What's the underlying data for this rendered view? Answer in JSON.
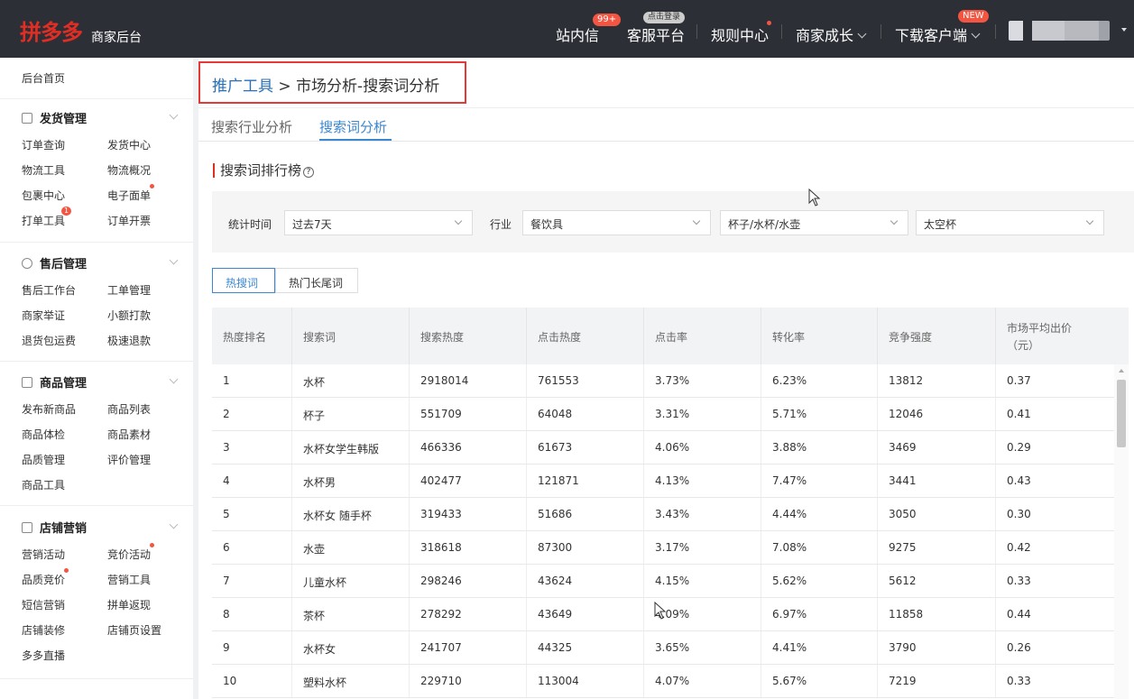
{
  "topbar": {
    "logo": "拼多多",
    "logo_sub": "商家后台",
    "nav": {
      "messages": "站内信",
      "messages_badge": "99+",
      "service": "客服平台",
      "service_badge": "点击登录",
      "rules": "规则中心",
      "growth": "商家成长",
      "download": "下载客户端",
      "download_badge": "NEW"
    }
  },
  "sidebar": {
    "home": "后台首页",
    "sections": [
      {
        "title": "发货管理",
        "links": [
          "订单查询",
          "发货中心",
          "物流工具",
          "物流概况",
          "包裹中心",
          "电子面单",
          "打单工具",
          "订单开票"
        ]
      },
      {
        "title": "售后管理",
        "links": [
          "售后工作台",
          "工单管理",
          "商家举证",
          "小额打款",
          "退货包运费",
          "极速退款"
        ]
      },
      {
        "title": "商品管理",
        "links": [
          "发布新商品",
          "商品列表",
          "商品体检",
          "商品素材",
          "品质管理",
          "评价管理",
          "商品工具"
        ]
      },
      {
        "title": "店铺营销",
        "links": [
          "营销活动",
          "竞价活动",
          "品质竞价",
          "营销工具",
          "短信营销",
          "拼单返现",
          "店铺装修",
          "店铺页设置",
          "多多直播"
        ]
      }
    ],
    "badge_print": "1"
  },
  "main": {
    "breadcrumb_link": "推广工具",
    "breadcrumb_sep": " > ",
    "breadcrumb_current": "市场分析-搜索词分析",
    "tabs": [
      "搜索行业分析",
      "搜索词分析"
    ],
    "section_title": "搜索词排行榜",
    "filters": {
      "time_label": "统计时间",
      "time_value": "过去7天",
      "industry_label": "行业",
      "industry_value": "餐饮具",
      "cat2_value": "杯子/水杯/水壶",
      "cat3_value": "太空杯"
    },
    "segments": [
      "热搜词",
      "热门长尾词"
    ],
    "columns": [
      "热度排名",
      "搜索词",
      "搜索热度",
      "点击热度",
      "点击率",
      "转化率",
      "竞争强度",
      "市场平均出价",
      "（元）"
    ],
    "rows": [
      [
        "1",
        "水杯",
        "2918014",
        "761553",
        "3.73%",
        "6.23%",
        "13812",
        "0.37"
      ],
      [
        "2",
        "杯子",
        "551709",
        "64048",
        "3.31%",
        "5.71%",
        "12046",
        "0.41"
      ],
      [
        "3",
        "水杯女学生韩版",
        "466336",
        "61673",
        "4.06%",
        "3.88%",
        "3469",
        "0.29"
      ],
      [
        "4",
        "水杯男",
        "402477",
        "121871",
        "4.13%",
        "7.47%",
        "3441",
        "0.43"
      ],
      [
        "5",
        "水杯女 随手杯",
        "319433",
        "51686",
        "3.43%",
        "4.44%",
        "3050",
        "0.30"
      ],
      [
        "6",
        "水壶",
        "318618",
        "87300",
        "3.17%",
        "7.08%",
        "9275",
        "0.42"
      ],
      [
        "7",
        "儿童水杯",
        "298246",
        "43624",
        "4.15%",
        "5.62%",
        "5612",
        "0.33"
      ],
      [
        "8",
        "茶杯",
        "278292",
        "43649",
        "4.09%",
        "6.97%",
        "11858",
        "0.44"
      ],
      [
        "9",
        "水杯女",
        "241707",
        "44325",
        "3.65%",
        "4.41%",
        "3790",
        "0.26"
      ],
      [
        "10",
        "塑料水杯",
        "229710",
        "113004",
        "4.07%",
        "5.67%",
        "7219",
        "0.33"
      ]
    ]
  }
}
